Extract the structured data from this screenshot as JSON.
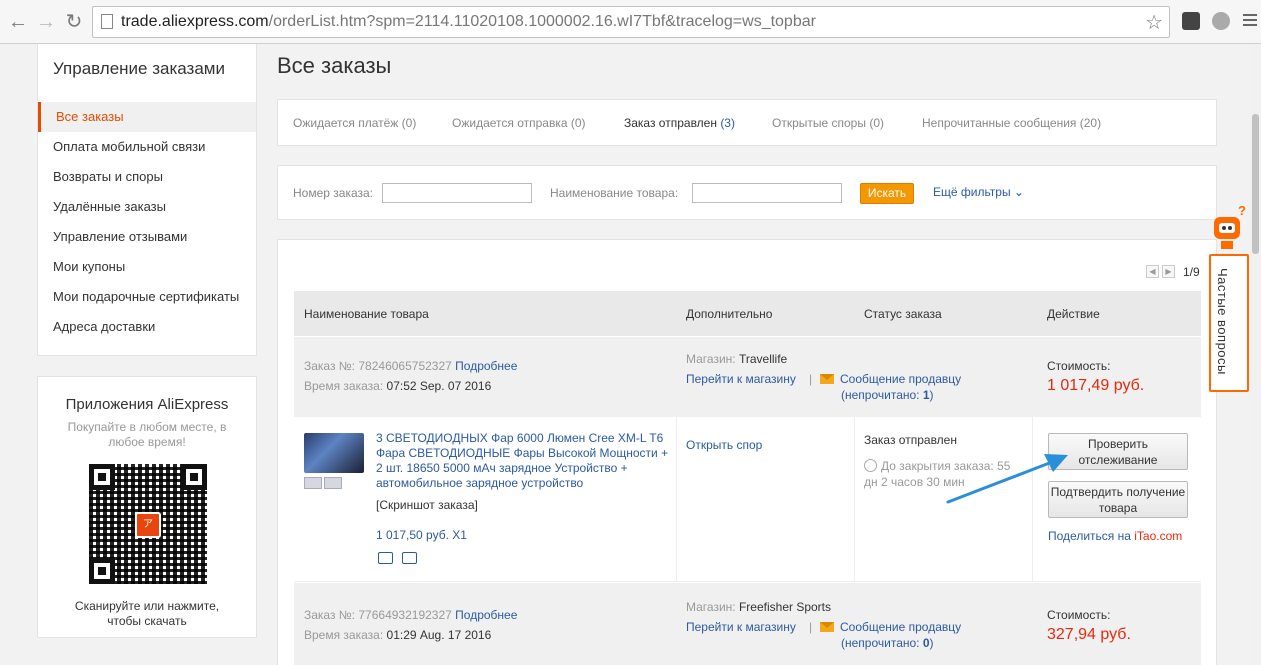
{
  "browser": {
    "url_host": "trade.aliexpress.com",
    "url_path": "/orderList.htm?spm=2114.11020108.1000002.16.wI7Tbf&tracelog=ws_topbar"
  },
  "sidebar": {
    "title": "Управление заказами",
    "items": [
      {
        "label": "Все заказы"
      },
      {
        "label": "Оплата мобильной связи"
      },
      {
        "label": "Возвраты и споры"
      },
      {
        "label": "Удалённые заказы"
      },
      {
        "label": "Управление отзывами"
      },
      {
        "label": "Мои купоны"
      },
      {
        "label": "Мои подарочные сертификаты"
      },
      {
        "label": "Адреса доставки"
      }
    ]
  },
  "apps": {
    "title": "Приложения AliExpress",
    "subtitle": "Покупайте в любом месте, в любое время!",
    "qr_logo": "AliExpress",
    "bottom": "Сканируйте или нажмите, чтобы скачать"
  },
  "page_title": "Все заказы",
  "tabs": [
    {
      "label": "Ожидается платёж",
      "count": "(0)"
    },
    {
      "label": "Ожидается отправка",
      "count": "(0)"
    },
    {
      "label": "Заказ отправлен",
      "count": "(3)"
    },
    {
      "label": "Открытые споры",
      "count": "(0)"
    },
    {
      "label": "Непрочитанные сообщения",
      "count": "(20)"
    }
  ],
  "filters": {
    "order_number_label": "Номер заказа:",
    "order_number_value": "",
    "product_name_label": "Наименование товара:",
    "product_name_value": "",
    "search_button": "Искать",
    "more_filters": "Ещё фильтры"
  },
  "pager": {
    "page": "1/9"
  },
  "table_headers": [
    "Наименование товара",
    "Дополнительно",
    "Статус заказа",
    "Действие"
  ],
  "orders": [
    {
      "order_no_label": "Заказ №:",
      "order_no": "78246065752327",
      "details_link": "Подробнее",
      "time_label": "Время заказа:",
      "time": "07:52 Sep. 07 2016",
      "shop_label": "Магазин:",
      "shop": "Travellife",
      "go_to_shop": "Перейти к магазину",
      "separator": "|",
      "message_seller": "Сообщение продавцу",
      "unread_prefix": "(непрочитано:",
      "unread_count": "1",
      "unread_suffix": ")",
      "cost_label": "Стоимость:",
      "cost": "1 017,49 руб.",
      "product": {
        "name": "3 СВЕТОДИОДНЫХ Фар 6000 Люмен Cree XM-L T6 Фара СВЕТОДИОДНЫЕ Фары Высокой Мощности + 2 шт. 18650 5000 мАч зарядное Устройство + автомобильное зарядное устройство",
        "screenshot": "[Скриншот заказа]",
        "price": "1 017,50 руб. X1"
      },
      "open_dispute": "Открыть спор",
      "status": "Заказ отправлен",
      "closing_line1": "До закрытия заказа: 55",
      "closing_line2": "дн 2 часов 30 мин",
      "btn_track": "Проверить отслеживание",
      "btn_confirm": "Подтвердить получение товара",
      "share_prefix": "Поделиться на ",
      "share_brand": "iTao.com"
    },
    {
      "order_no_label": "Заказ №:",
      "order_no": "77664932192327",
      "details_link": "Подробнее",
      "time_label": "Время заказа:",
      "time": "01:29 Aug. 17 2016",
      "shop_label": "Магазин:",
      "shop": "Freefisher Sports",
      "go_to_shop": "Перейти к магазину",
      "separator": "|",
      "message_seller": "Сообщение продавцу",
      "unread_prefix": "(непрочитано:",
      "unread_count": "0",
      "unread_suffix": ")",
      "cost_label": "Стоимость:",
      "cost": "327,94 руб."
    }
  ],
  "faq": {
    "label": "Частые вопросы"
  },
  "colors": {
    "accent": "#e64b00",
    "link": "#2b5aa3",
    "price": "#e8290b",
    "search_button": "#f39800"
  }
}
